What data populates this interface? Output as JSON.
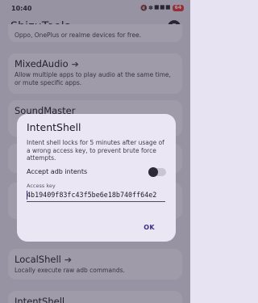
{
  "status_bar": {
    "time": "10:40",
    "signal": "🔇 ✽ ⯀ ⯀ ⯀",
    "battery": "64"
  },
  "app_bar": {
    "title": "ShizuTools"
  },
  "list": {
    "partial_desc": "Oppo, OnePlus or realme devices for free.",
    "cards": [
      {
        "title": "MixedAudio",
        "desc": "Allow multiple apps to play audio at the same time, or mute specific apps."
      },
      {
        "title": "SoundMaster",
        "desc": ""
      },
      {
        "title": "",
        "desc": ""
      },
      {
        "title": "",
        "desc": ""
      },
      {
        "title": "LocalShell",
        "desc": "Locally execute raw adb commands."
      },
      {
        "title": "IntentShell",
        "desc": ""
      }
    ]
  },
  "dialog": {
    "title": "IntentShell",
    "message": "Intent shell locks for 5 minutes after usage of a wrong access key, to prevent brute force attempts.",
    "toggle_label": "Accept adb intents",
    "toggle_on": false,
    "field_label": "Access key",
    "field_value": "4b19409f83fc43f5be6e18b740ff64e2",
    "ok_label": "OK"
  },
  "colors": {
    "background": "#e7e3f2",
    "card": "#f4f1fa",
    "dialog": "#ebe6f3",
    "accent": "#3a2f86"
  },
  "icons": {
    "github": "github-icon",
    "arrow": "arrow-right-icon"
  }
}
